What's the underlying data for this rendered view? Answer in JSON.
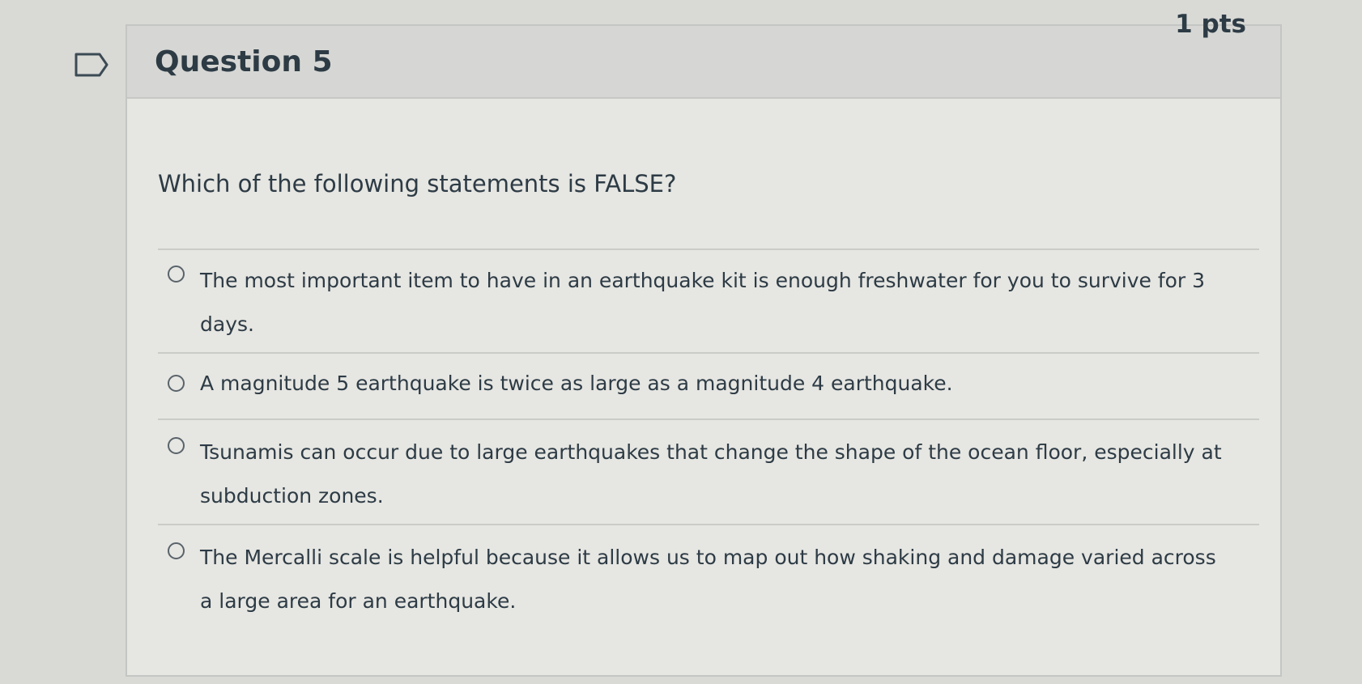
{
  "question": {
    "title": "Question 5",
    "points": "1 pts",
    "prompt": "Which of the following statements is FALSE?"
  },
  "answers": [
    {
      "label": "The most important item to have in an earthquake kit is enough freshwater for you to survive for 3 days.",
      "selected": false
    },
    {
      "label": "A magnitude 5 earthquake is twice as large as a magnitude 4 earthquake.",
      "selected": false
    },
    {
      "label": "Tsunamis can occur due to large earthquakes that change the shape of the ocean floor, especially at subduction zones.",
      "selected": false
    },
    {
      "label": "The Mercalli scale is helpful because it allows us to map out how shaking and damage varied across a large area for an earthquake.",
      "selected": false
    }
  ],
  "icons": {
    "flag": "flag-icon",
    "radio": "radio-button-icon"
  },
  "colors": {
    "text": "#2d3b45",
    "border": "#c4c6c3",
    "header_background": "#d6d7d4",
    "card_background": "#e6e6e2"
  }
}
